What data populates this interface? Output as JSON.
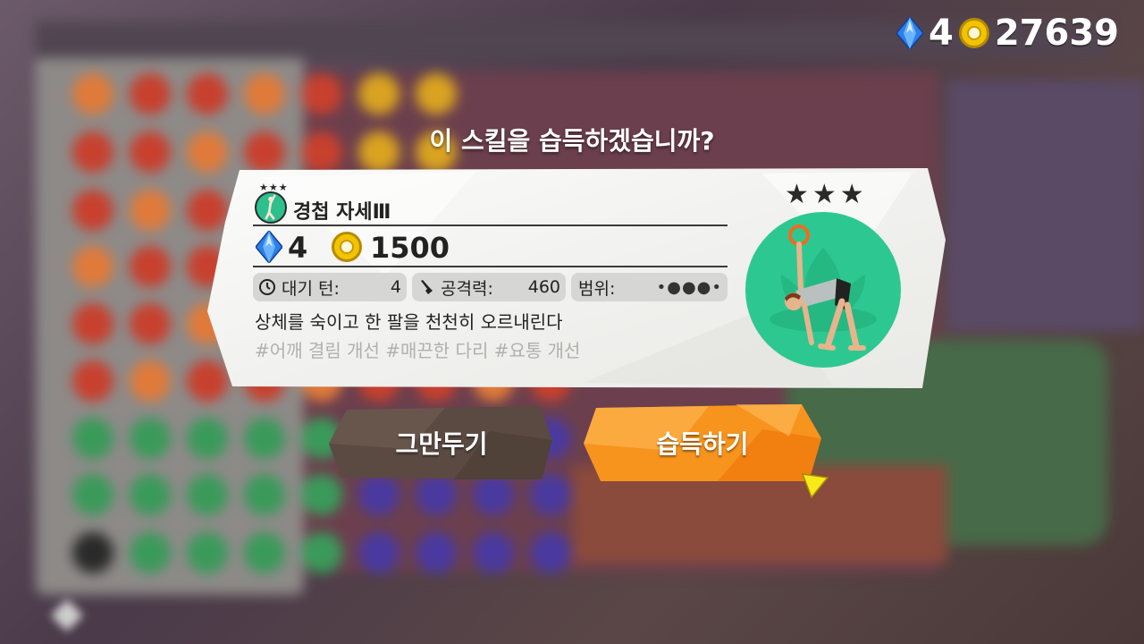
{
  "currency": {
    "gems": "4",
    "coins": "27639"
  },
  "dialog": {
    "question": "이 스킬을 습득하겠습니까?"
  },
  "skill": {
    "rank": "★★★",
    "name": "경첩 자세Ⅲ",
    "cost_gems": "4",
    "cost_coins": "1500",
    "wait_turns_label": "대기 턴:",
    "wait_turns_value": "4",
    "attack_label": "공격력:",
    "attack_value": "460",
    "range_label": "범위:",
    "range_indicator": "•●●●•",
    "description": "상체를 숙이고 한 팔을 천천히 오르내린다",
    "tags": "#어깨 결림 개선 #매끈한 다리 #요통 개선",
    "icon": "hinge-pose-icon"
  },
  "buttons": {
    "cancel": "그만두기",
    "acquire": "습득하기"
  },
  "colors": {
    "accent_orange": "#f7941d",
    "cancel_brown": "#5a4a42",
    "skill_green": "#2dc891",
    "gem_blue": "#2f7fe8",
    "coin_gold": "#f2c300"
  }
}
